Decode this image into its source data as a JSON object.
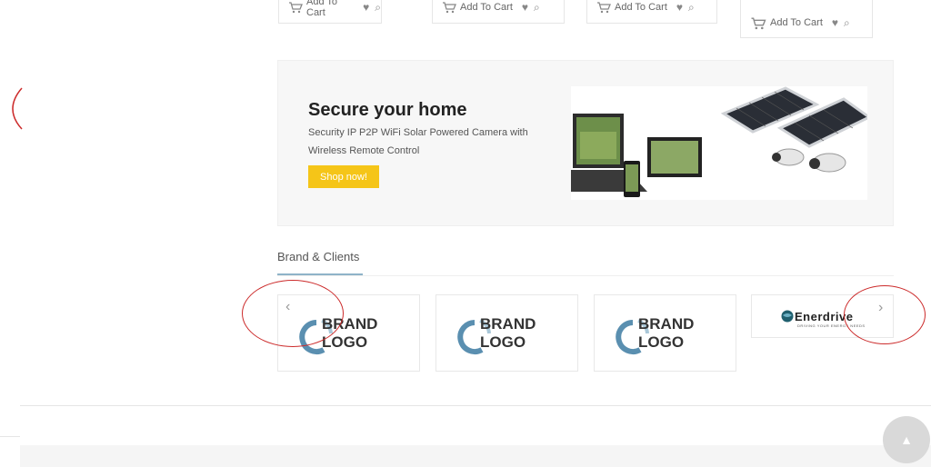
{
  "products": {
    "items": [
      {
        "add_label": "Add To Cart"
      },
      {
        "add_label": "Add To Cart"
      },
      {
        "add_label": "Add To Cart"
      },
      {
        "add_label": "Add To Cart"
      }
    ]
  },
  "banner": {
    "title": "Secure your home",
    "description": "Security IP P2P WiFi Solar Powered Camera with Wireless Remote Control",
    "button_label": "Shop now!"
  },
  "brands": {
    "section_title": "Brand & Clients",
    "items": [
      {
        "line1": "BRAND",
        "line2": "LOGO"
      },
      {
        "line1": "BRAND",
        "line2": "LOGO"
      },
      {
        "line1": "BRAND",
        "line2": "LOGO"
      },
      {
        "name": "Enerdrive",
        "tagline": "DRIVING YOUR ENERGY NEEDS"
      }
    ],
    "prev_glyph": "‹",
    "next_glyph": "›"
  },
  "colors": {
    "accent": "#f5c518",
    "annotation": "#cc2b2b",
    "logo_blue": "#5a8fb0"
  }
}
